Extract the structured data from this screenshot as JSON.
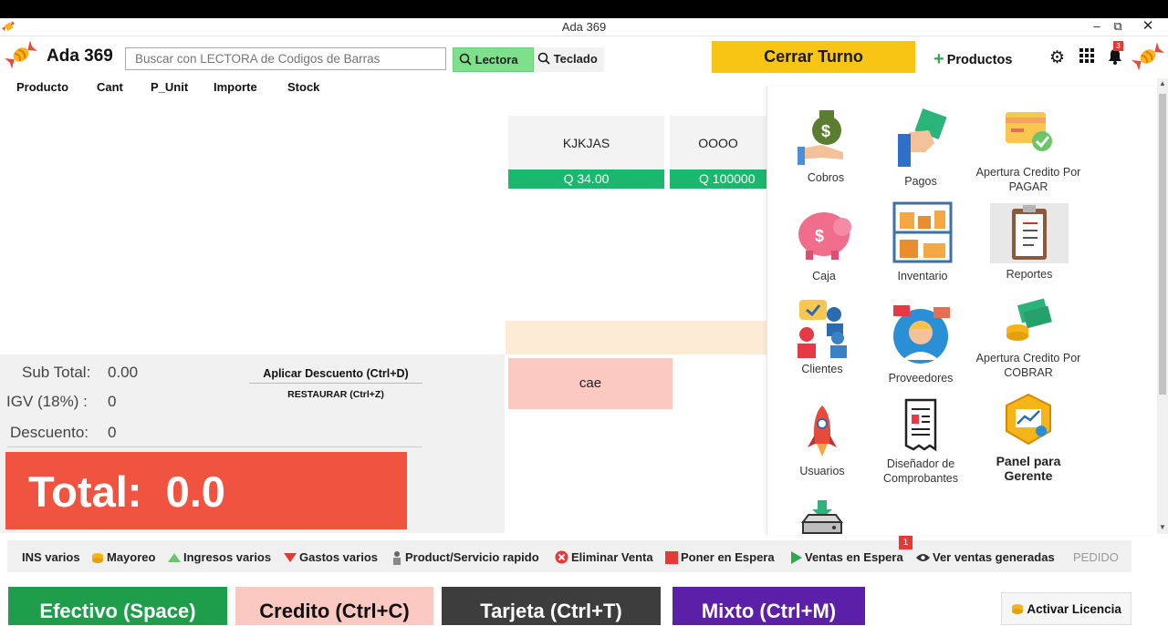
{
  "window": {
    "title": "Ada 369",
    "minimize": "–",
    "restore": "⧉",
    "close": "✕"
  },
  "app": {
    "name": "Ada 369"
  },
  "search": {
    "placeholder": "Buscar con LECTORA de Codigos de Barras",
    "lectora_label": "Lectora",
    "teclado_label": "Teclado"
  },
  "header": {
    "cerrar_turno": "Cerrar Turno",
    "productos": "Productos",
    "notification_count": "3"
  },
  "table": {
    "columns": [
      "Producto",
      "Cant",
      "P_Unit",
      "Importe",
      "Stock"
    ]
  },
  "product_cards": [
    {
      "name": "KJKJAS",
      "price": "Q 34.00"
    },
    {
      "name": "OOOO",
      "price": "Q 100000"
    }
  ],
  "category_tile": {
    "label": "cae"
  },
  "totals": {
    "subtotal_label": "Sub Total:",
    "subtotal_value": "0.00",
    "igv_label": "IGV (18%) :",
    "igv_value": "0",
    "descuento_label": "Descuento:",
    "descuento_value": "0",
    "aplicar_descuento": "Aplicar Descuento (Ctrl+D)",
    "restaurar": "RESTAURAR (Ctrl+Z)",
    "total_label": "Total:",
    "total_value": "0.0"
  },
  "menu": [
    {
      "label": "Cobros",
      "icon": "money-bag-hand-icon"
    },
    {
      "label": "Pagos",
      "icon": "cash-payment-hand-icon"
    },
    {
      "label": "Apertura Credito Por PAGAR",
      "icon": "credit-card-check-icon"
    },
    {
      "label": "Caja",
      "icon": "piggy-bank-icon"
    },
    {
      "label": "Inventario",
      "icon": "warehouse-shelves-icon"
    },
    {
      "label": "Reportes",
      "icon": "clipboard-report-icon"
    },
    {
      "label": "Clientes",
      "icon": "customers-chat-icon"
    },
    {
      "label": "Proveedores",
      "icon": "supplier-avatar-icon"
    },
    {
      "label": "Apertura Credito Por COBRAR",
      "icon": "coins-bills-icon"
    },
    {
      "label": "Usuarios",
      "icon": "rocket-icon"
    },
    {
      "label": "Diseñador de Comprobantes",
      "icon": "receipt-document-icon"
    },
    {
      "label": "Panel para Gerente",
      "icon": "manager-dashboard-icon"
    },
    {
      "label": "",
      "icon": "download-drive-icon"
    }
  ],
  "actions": {
    "ins_varios": "INS varios",
    "mayoreo": "Mayoreo",
    "ingresos": "Ingresos varios",
    "gastos": "Gastos varios",
    "product_rapido": "Product/Servicio rapido",
    "eliminar": "Eliminar Venta",
    "poner_espera": "Poner en Espera",
    "ventas_espera": "Ventas en Espera",
    "ventas_espera_count": "1",
    "ver_ventas": "Ver ventas generadas",
    "pedido": "PEDIDO"
  },
  "payments": {
    "efectivo": "Efectivo (Space)",
    "credito": "Credito  (Ctrl+C)",
    "tarjeta": "Tarjeta (Ctrl+T)",
    "mixto": "Mixto (Ctrl+M)",
    "activar": "Activar Licencia"
  },
  "colors": {
    "accent_yellow": "#f9c515",
    "lectora_green": "#7ee08a",
    "price_green": "#1ab76e",
    "total_red": "#f0533f",
    "efectivo_green": "#1e9e4a",
    "credito_pink": "#fcc8c2",
    "tarjeta_gray": "#3d3d3d",
    "mixto_purple": "#5b1fa8"
  }
}
